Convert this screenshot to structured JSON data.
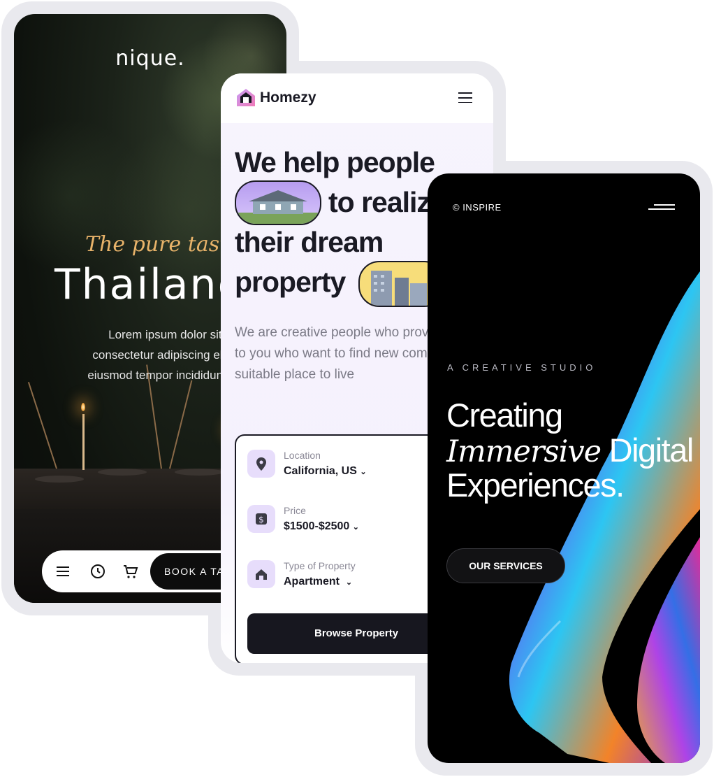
{
  "nique": {
    "logo": "nique.",
    "tagline": "The pure taste of",
    "title": "Thailand",
    "body_lines": [
      "Lorem ipsum dolor sit amet,",
      "consectetur adipiscing elit, sed do",
      "eiusmod tempor incididunt ut labore"
    ],
    "icons": [
      "menu-icon",
      "clock-icon",
      "cart-icon"
    ],
    "book_label": "BOOK A TABLE"
  },
  "homezy": {
    "brand": "Homezy",
    "headline_lines": [
      "We help people",
      "to realize",
      "their dream",
      "property"
    ],
    "description": "We are creative people who provide the best way to you who want to find new comfortable and suitable place to live",
    "fields": [
      {
        "label": "Location",
        "value": "California, US",
        "icon": "location-pin-icon"
      },
      {
        "label": "Price",
        "value": "$1500-$2500",
        "icon": "dollar-icon"
      },
      {
        "label": "Type of Property",
        "value": "Apartment",
        "icon": "house-icon"
      }
    ],
    "browse_label": "Browse Property",
    "accent": "#e7ddfb"
  },
  "inspire": {
    "logo": "© INSPIRE",
    "kicker": "A CREATIVE STUDIO",
    "heading_line1": "Creating",
    "heading_italic": "Immersive",
    "heading_line2_rest": "Digital",
    "heading_line3": "Experiences.",
    "cta_label": "OUR SERVICES"
  }
}
